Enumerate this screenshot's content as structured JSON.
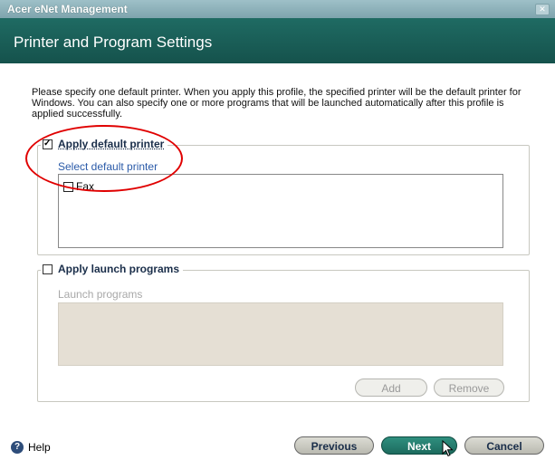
{
  "window": {
    "title": "Acer eNet Management"
  },
  "header": {
    "title": "Printer and Program Settings"
  },
  "description": "Please specify one default printer. When you apply this profile, the specified printer will be the default printer for Windows. You can also specify one or more programs that will be launched automatically after this profile is applied successfully.",
  "printer_group": {
    "label": "Apply default printer",
    "checked": true,
    "sub_label": "Select default printer",
    "items": [
      {
        "label": "Fax",
        "checked": false
      }
    ]
  },
  "programs_group": {
    "label": "Apply launch programs",
    "checked": false,
    "sub_label": "Launch programs",
    "add_label": "Add",
    "remove_label": "Remove"
  },
  "footer": {
    "help_label": "Help",
    "previous_label": "Previous",
    "next_label": "Next",
    "cancel_label": "Cancel"
  }
}
